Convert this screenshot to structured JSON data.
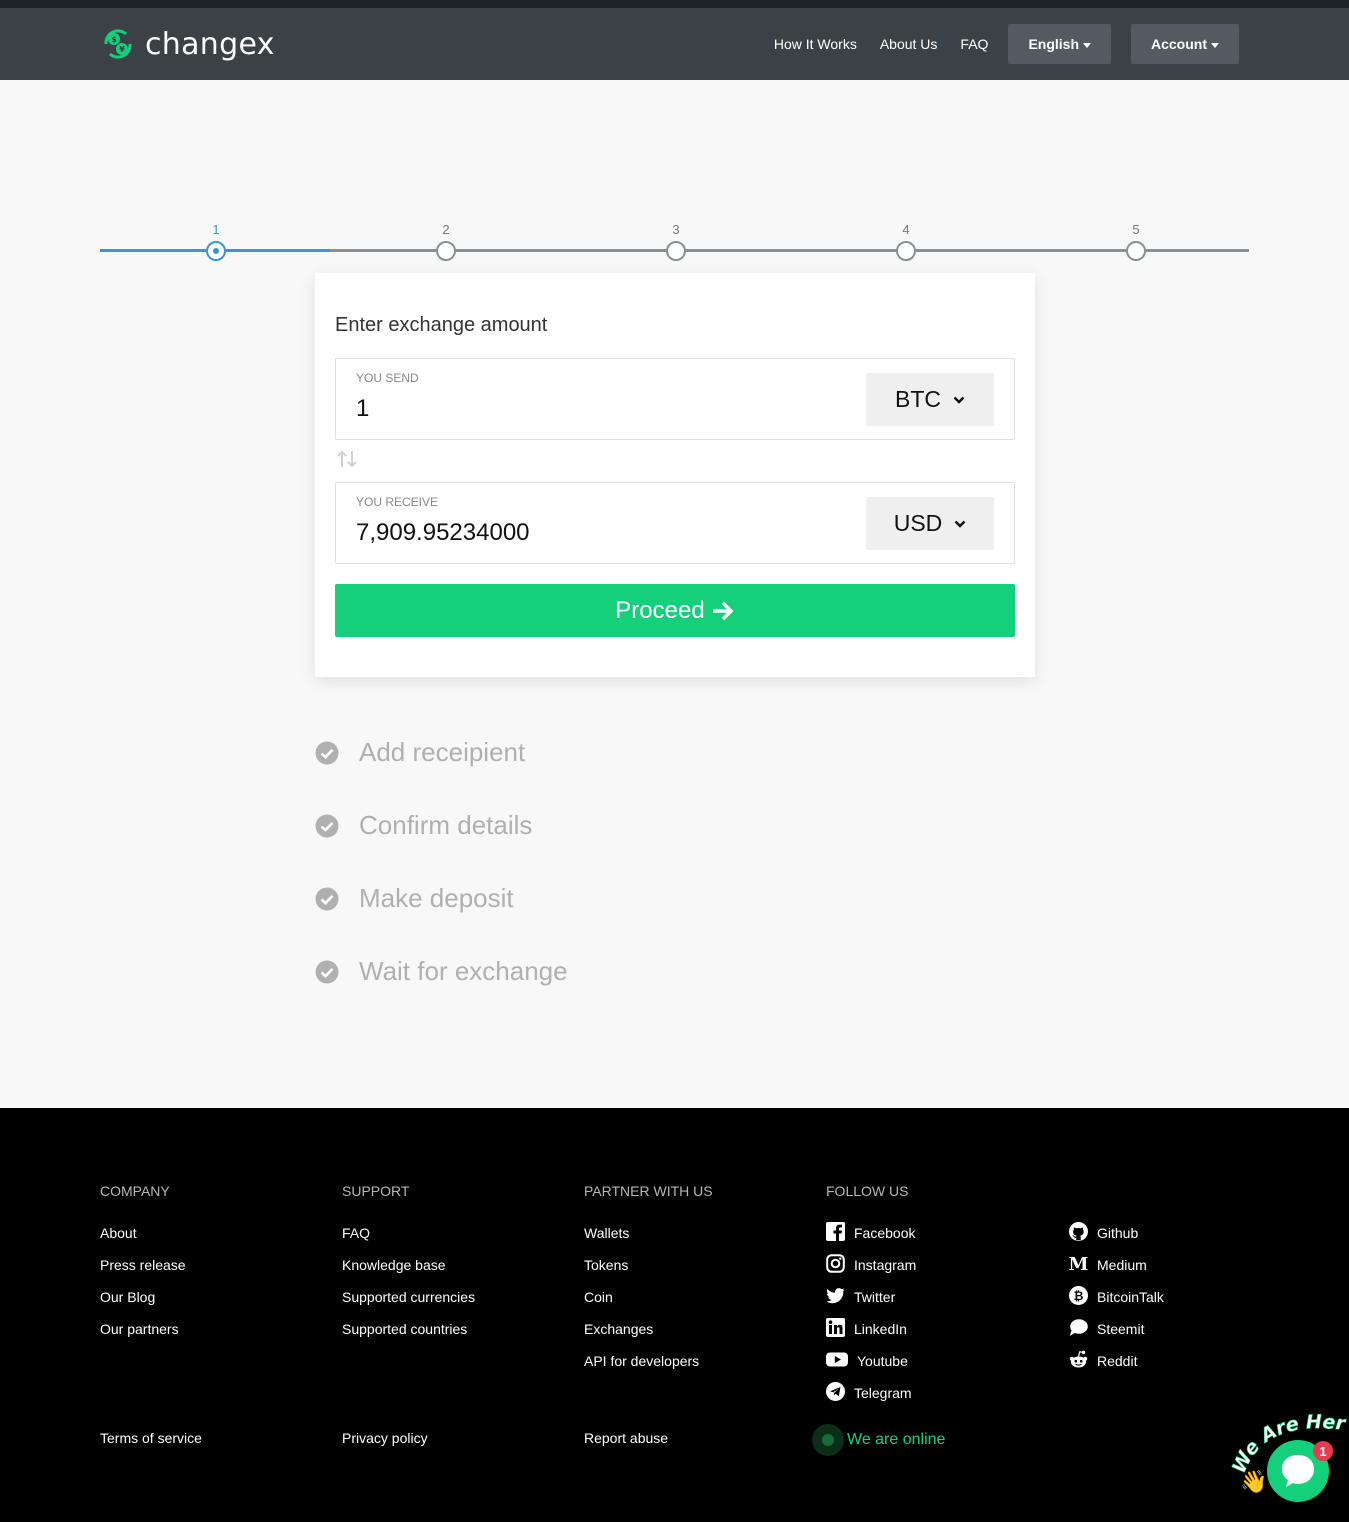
{
  "header": {
    "brand": "changex",
    "nav": [
      "How It Works",
      "About Us",
      "FAQ"
    ],
    "language": "English",
    "account": "Account"
  },
  "stepper": {
    "steps": [
      "1",
      "2",
      "3",
      "4",
      "5"
    ],
    "active": 1
  },
  "exchange": {
    "title": "Enter exchange amount",
    "send": {
      "label": "YOU SEND",
      "value": "1",
      "currency": "BTC"
    },
    "receive": {
      "label": "YOU RECEIVE",
      "value": "7,909.95234000",
      "currency": "USD"
    },
    "proceed": "Proceed"
  },
  "upcoming_steps": [
    "Add receipient",
    "Confirm details",
    "Make deposit",
    "Wait for exchange"
  ],
  "footer": {
    "company": {
      "heading": "COMPANY",
      "links": [
        "About",
        "Press release",
        "Our Blog",
        "Our partners"
      ]
    },
    "support": {
      "heading": "SUPPORT",
      "links": [
        "FAQ",
        "Knowledge base",
        "Supported currencies",
        "Supported countries"
      ]
    },
    "partner": {
      "heading": "PARTNER WITH US",
      "links": [
        "Wallets",
        "Tokens",
        "Coin",
        "Exchanges",
        "API for developers"
      ]
    },
    "follow": {
      "heading": "FOLLOW US",
      "col1": [
        {
          "label": "Facebook",
          "icon": "facebook-icon"
        },
        {
          "label": "Instagram",
          "icon": "instagram-icon"
        },
        {
          "label": "Twitter",
          "icon": "twitter-icon"
        },
        {
          "label": "LinkedIn",
          "icon": "linkedin-icon"
        },
        {
          "label": "Youtube",
          "icon": "youtube-icon"
        },
        {
          "label": "Telegram",
          "icon": "telegram-icon"
        }
      ],
      "col2": [
        {
          "label": "Github",
          "icon": "github-icon"
        },
        {
          "label": "Medium",
          "icon": "medium-icon"
        },
        {
          "label": "BitcoinTalk",
          "icon": "bitcoin-icon"
        },
        {
          "label": "Steemit",
          "icon": "steemit-icon"
        },
        {
          "label": "Reddit",
          "icon": "reddit-icon"
        }
      ]
    },
    "bottom": {
      "terms": "Terms of service",
      "privacy": "Privacy policy",
      "abuse": "Report abuse",
      "online": "We are online"
    }
  },
  "chat": {
    "badge_text": "We Are Here!",
    "unread": "1"
  },
  "colors": {
    "header": "#3b4145",
    "accent_green": "#14d07a",
    "accent_blue": "#3b97d3"
  }
}
